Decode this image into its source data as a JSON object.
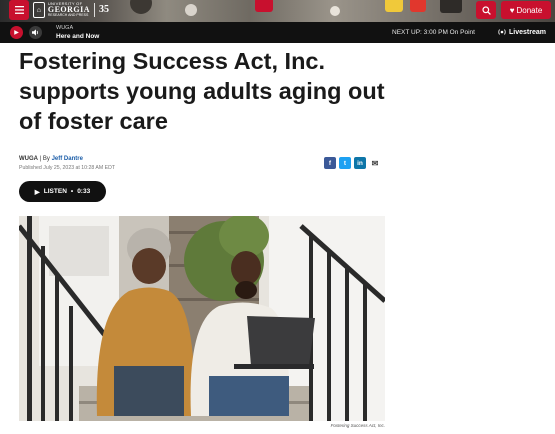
{
  "header": {
    "logo": {
      "line1": "UNIVERSITY OF",
      "line2": "GEORGIA",
      "line3": "RESEARCH AND PRESS",
      "anniversary": "35"
    },
    "donate_label": "Donate",
    "menu_icon": "hamburger-icon",
    "search_icon": "search-icon",
    "donate_icon": "heart-icon"
  },
  "player": {
    "station": "WUGA",
    "program": "Here and Now",
    "next_up": "NEXT UP: 3:00 PM On Point",
    "livestream_label": "Livestream"
  },
  "article": {
    "headline": "Fostering Success Act, Inc. supports young adults aging out of foster care",
    "source": "WUGA",
    "by_label": "| By",
    "author": "Jeff Dantre",
    "published": "Published July 25, 2023 at 10:28 AM EDT",
    "listen_label": "LISTEN",
    "listen_duration": "0:33",
    "photo_credit": "Fostering Success Act, Inc."
  },
  "share_icons": [
    "facebook-icon",
    "twitter-icon",
    "linkedin-icon",
    "email-icon"
  ],
  "colors": {
    "brand_red": "#c8102e",
    "player_bg": "#111111",
    "author_link": "#1b5da8"
  }
}
